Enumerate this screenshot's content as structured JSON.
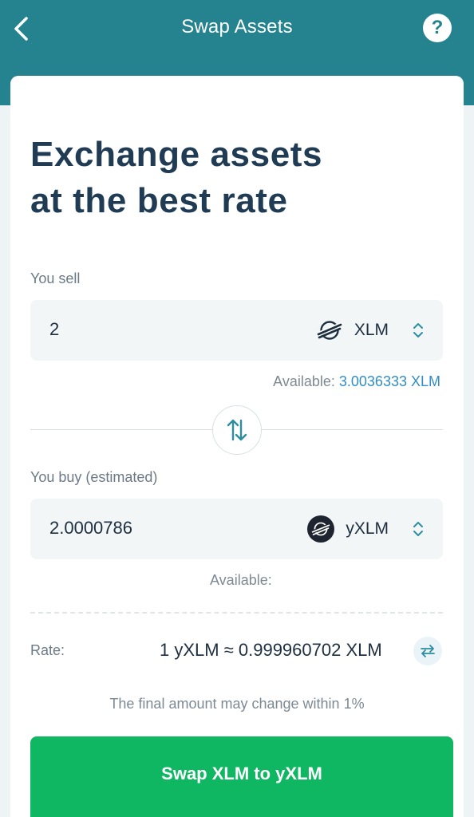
{
  "header": {
    "title": "Swap Assets",
    "back_icon": "chevron-left-icon",
    "help_label": "?"
  },
  "headline": {
    "line1": "Exchange assets",
    "line2": "at the best rate"
  },
  "sell": {
    "label": "You sell",
    "amount": "2",
    "asset_code": "XLM",
    "asset_icon": "stellar-logo-icon",
    "available_label": "Available:",
    "available_value": "3.0036333 XLM"
  },
  "buy": {
    "label": "You buy (estimated)",
    "amount": "2.0000786",
    "asset_code": "yXLM",
    "asset_icon": "yxlm-logo-icon",
    "available_label": "Available:"
  },
  "rate": {
    "label": "Rate:",
    "value": "1 yXLM ≈ 0.999960702 XLM"
  },
  "note": "The final amount may change within 1%",
  "cta": {
    "label": "Swap XLM to yXLM"
  },
  "colors": {
    "header": "#24838f",
    "headline": "#203c55",
    "accent_link": "#2f8fc8",
    "cta": "#10b762"
  }
}
